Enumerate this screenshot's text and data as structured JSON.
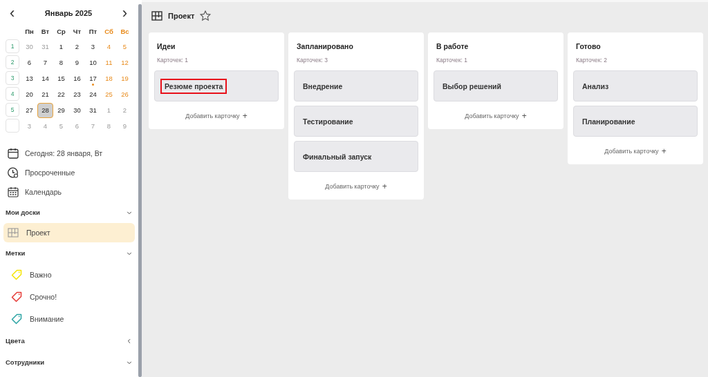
{
  "calendar": {
    "month": "Январь 2025",
    "prev": "‹",
    "next": "›",
    "weekdays": [
      {
        "label": "Пн",
        "weekend": false
      },
      {
        "label": "Вт",
        "weekend": false
      },
      {
        "label": "Ср",
        "weekend": false
      },
      {
        "label": "Чт",
        "weekend": false
      },
      {
        "label": "Пт",
        "weekend": false
      },
      {
        "label": "Сб",
        "weekend": true
      },
      {
        "label": "Вс",
        "weekend": true
      }
    ],
    "weeks": [
      {
        "number": "1",
        "days": [
          {
            "d": "30",
            "muted": true
          },
          {
            "d": "31",
            "muted": true
          },
          {
            "d": "1"
          },
          {
            "d": "2"
          },
          {
            "d": "3"
          },
          {
            "d": "4"
          },
          {
            "d": "5"
          }
        ]
      },
      {
        "number": "2",
        "days": [
          {
            "d": "6"
          },
          {
            "d": "7"
          },
          {
            "d": "8"
          },
          {
            "d": "9"
          },
          {
            "d": "10"
          },
          {
            "d": "11"
          },
          {
            "d": "12"
          }
        ]
      },
      {
        "number": "3",
        "days": [
          {
            "d": "13"
          },
          {
            "d": "14"
          },
          {
            "d": "15"
          },
          {
            "d": "16"
          },
          {
            "d": "17",
            "marked": true
          },
          {
            "d": "18"
          },
          {
            "d": "19"
          }
        ]
      },
      {
        "number": "4",
        "days": [
          {
            "d": "20"
          },
          {
            "d": "21"
          },
          {
            "d": "22"
          },
          {
            "d": "23"
          },
          {
            "d": "24"
          },
          {
            "d": "25"
          },
          {
            "d": "26"
          }
        ]
      },
      {
        "number": "5",
        "days": [
          {
            "d": "27"
          },
          {
            "d": "28",
            "selected": true
          },
          {
            "d": "29"
          },
          {
            "d": "30"
          },
          {
            "d": "31"
          },
          {
            "d": "1",
            "muted": true
          },
          {
            "d": "2",
            "muted": true
          }
        ]
      },
      {
        "days": [
          {
            "d": "3",
            "muted": true
          },
          {
            "d": "4",
            "muted": true
          },
          {
            "d": "5",
            "muted": true
          },
          {
            "d": "6",
            "muted": true
          },
          {
            "d": "7",
            "muted": true
          },
          {
            "d": "8",
            "muted": true
          },
          {
            "d": "9",
            "muted": true
          }
        ]
      }
    ]
  },
  "nav": [
    {
      "kind": "today",
      "label": "Сегодня: 28 января, Вт"
    },
    {
      "kind": "overdue",
      "label": "Просроченные"
    },
    {
      "kind": "calendar",
      "label": "Календарь"
    }
  ],
  "sections": [
    {
      "title": "Мои доски",
      "expanded": true,
      "items": [
        {
          "kind": "board",
          "label": "Проект",
          "selected": true
        }
      ]
    },
    {
      "title": "Метки",
      "expanded": true,
      "items": [
        {
          "kind": "tag",
          "label": "Важно",
          "color": "#f5e400"
        },
        {
          "kind": "tag",
          "label": "Срочно!",
          "color": "#e53935"
        },
        {
          "kind": "tag",
          "label": "Внимание",
          "color": "#2aa3a3"
        }
      ]
    },
    {
      "title": "Цвета",
      "expanded": false
    },
    {
      "title": "Сотрудники",
      "expanded": true
    }
  ],
  "board": {
    "title": "Проект",
    "starred": false,
    "columns": [
      {
        "title": "Идеи",
        "count": "Карточек: 1",
        "cards": [
          {
            "title": "Резюме проекта",
            "highlighted": true
          }
        ],
        "add": "Добавить карточку",
        "add_icon": "+"
      },
      {
        "title": "Запланировано",
        "count": "Карточек: 3",
        "cards": [
          {
            "title": "Внедрение",
            "highlighted": false
          },
          {
            "title": "Тестирование",
            "highlighted": false
          },
          {
            "title": "Финальный запуск",
            "highlighted": false
          }
        ],
        "add": "Добавить карточку",
        "add_icon": "+"
      },
      {
        "title": "В работе",
        "count": "Карточек: 1",
        "cards": [
          {
            "title": "Выбор решений",
            "highlighted": false
          }
        ],
        "add": "Добавить карточку",
        "add_icon": "+"
      },
      {
        "title": "Готово",
        "count": "Карточек: 2",
        "cards": [
          {
            "title": "Анализ",
            "highlighted": false
          },
          {
            "title": "Планирование",
            "highlighted": false
          }
        ],
        "add": "Добавить карточку",
        "add_icon": "+"
      }
    ]
  }
}
